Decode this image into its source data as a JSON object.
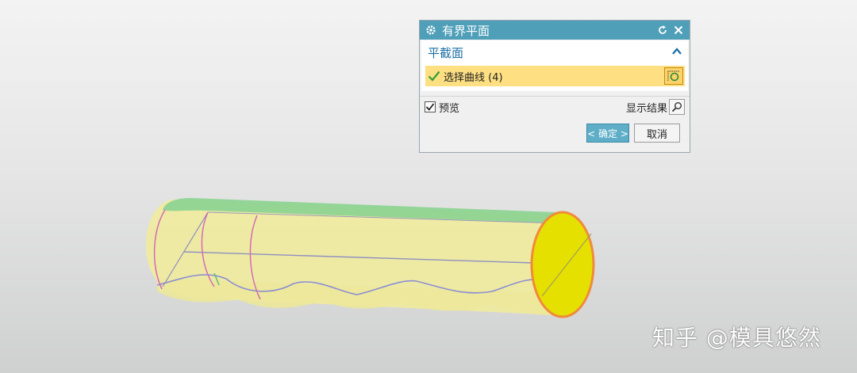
{
  "dialog": {
    "title": "有界平面",
    "icons": {
      "settings": "gear-icon",
      "reset": "reset-icon",
      "close": "close-icon"
    },
    "section": {
      "label": "平截面",
      "collapse_icon": "chevron-up-icon",
      "select_curve_label": "选择曲线 (4)",
      "select_curve_icon": "curve-select-icon",
      "checked_icon": "checkmark-icon"
    },
    "preview": {
      "label": "预览",
      "checked": true
    },
    "show_result": {
      "label": "显示结果",
      "icon": "magnifier-icon"
    },
    "buttons": {
      "ok_label": "< 确定 >",
      "cancel_label": "取消"
    }
  },
  "colors": {
    "titlebar": "#4f9fb9",
    "section_label": "#1d6fa5",
    "selection_highlight": "#fedf82",
    "ok_button": "#5faec8",
    "cylinder_body": "#f0ec9c",
    "cylinder_top_face": "#8ed492",
    "end_face": "#e6e000",
    "end_face_edge": "#f08a3c"
  },
  "watermark": "知乎 @模具悠然"
}
